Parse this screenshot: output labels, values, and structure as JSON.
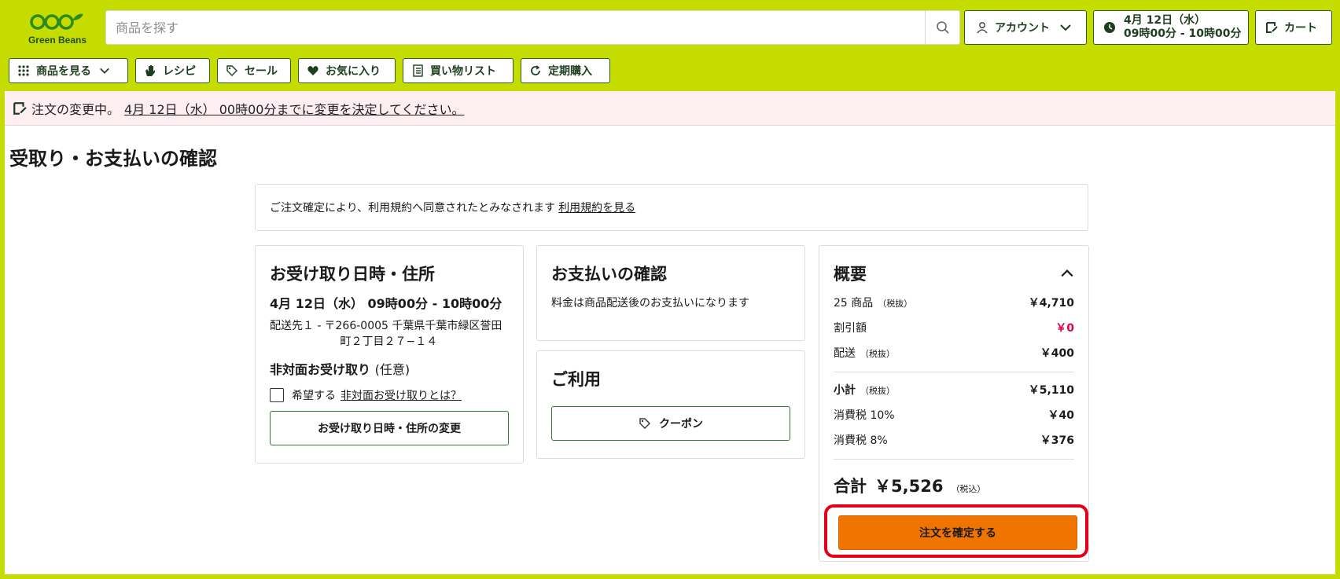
{
  "brand": {
    "name": "Green Beans",
    "color": "#c5dc00",
    "logo_color": "#2e8a1e"
  },
  "header": {
    "search_placeholder": "商品を探す",
    "account_label": "アカウント",
    "timeslot_date": "4月 12日（水）",
    "timeslot_time": "09時00分 - 10時00分",
    "cart_label": "カート"
  },
  "nav": {
    "items": [
      {
        "label": "商品を見る",
        "icon": "grid-icon"
      },
      {
        "label": "レシピ",
        "icon": "hand-icon"
      },
      {
        "label": "セール",
        "icon": "tag-icon"
      },
      {
        "label": "お気に入り",
        "icon": "heart-icon"
      },
      {
        "label": "買い物リスト",
        "icon": "list-icon"
      },
      {
        "label": "定期購入",
        "icon": "refresh-icon"
      }
    ]
  },
  "notice": {
    "prefix": "注文の変更中。",
    "link": "4月 12日（水） 00時00分までに変更を決定してください。",
    "bg": "#fdeef2"
  },
  "page": {
    "title": "受取り・お支払いの確認",
    "terms_text": "ご注文確定により、利用規約へ同意されたとみなされます",
    "terms_link": "利用規約を見る"
  },
  "pickup": {
    "title": "お受け取り日時・住所",
    "datetime": "4月 12日（水） 09時00分 - 10時00分",
    "address_label": "配送先１ -",
    "address_line1": "〒266-0005 千葉県千葉市緑区誉田",
    "address_line2": "町２丁目２７−１４",
    "contactless_title": "非対面お受け取り",
    "contactless_optional": "(任意)",
    "contactless_checkbox": "希望する",
    "contactless_link": "非対面お受け取りとは？",
    "change_button": "お受け取り日時・住所の変更"
  },
  "payment": {
    "title": "お支払いの確認",
    "description": "料金は商品配送後のお支払いになります"
  },
  "usage": {
    "title": "ご利用",
    "coupon_button": "クーポン"
  },
  "summary": {
    "title": "概要",
    "items_label": "25 商品",
    "tax_excluded": "（税抜）",
    "items_value": "￥4,710",
    "discount_label": "割引額",
    "discount_value": "￥0",
    "shipping_label": "配送",
    "shipping_value": "￥400",
    "subtotal_label": "小計",
    "subtotal_value": "￥5,110",
    "tax10_label": "消費税 10%",
    "tax10_value": "￥40",
    "tax8_label": "消費税 8%",
    "tax8_value": "￥376",
    "total_label": "合計",
    "total_value": "￥5,526",
    "tax_included": "（税込）",
    "confirm_button": "注文を確定する"
  },
  "colors": {
    "accent": "#c5dc00",
    "confirm": "#ef7400",
    "highlight": "#e4001b",
    "discount": "#e0004d"
  }
}
